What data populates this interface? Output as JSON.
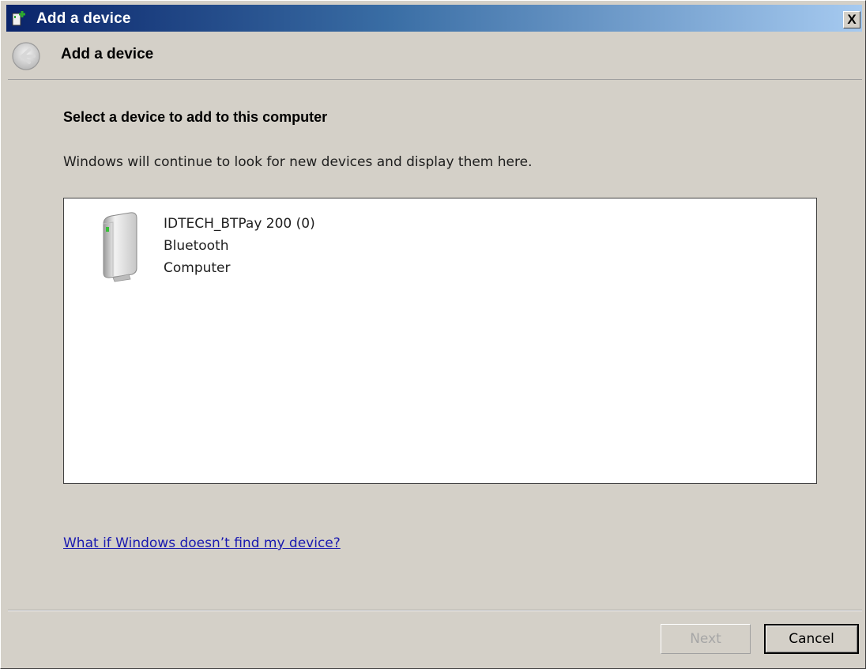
{
  "window": {
    "title": "Add a device",
    "close_label": "X"
  },
  "header": {
    "title": "Add a device",
    "back_icon": "back-arrow-icon"
  },
  "content": {
    "heading": "Select a device to add to this computer",
    "subtext": "Windows will continue to look for new devices and display them here.",
    "devices": [
      {
        "name": "IDTECH_BTPay 200 (0)",
        "type": "Bluetooth",
        "category": "Computer",
        "icon": "computer-device-icon"
      }
    ],
    "help_link": "What if Windows doesn’t find my device?"
  },
  "footer": {
    "next_label": "Next",
    "cancel_label": "Cancel"
  },
  "colors": {
    "titlebar_start": "#0a246a",
    "titlebar_end": "#a6caf0",
    "background": "#d4d0c8",
    "link": "#1a1ab0",
    "disabled_text": "#a6a6a6"
  }
}
